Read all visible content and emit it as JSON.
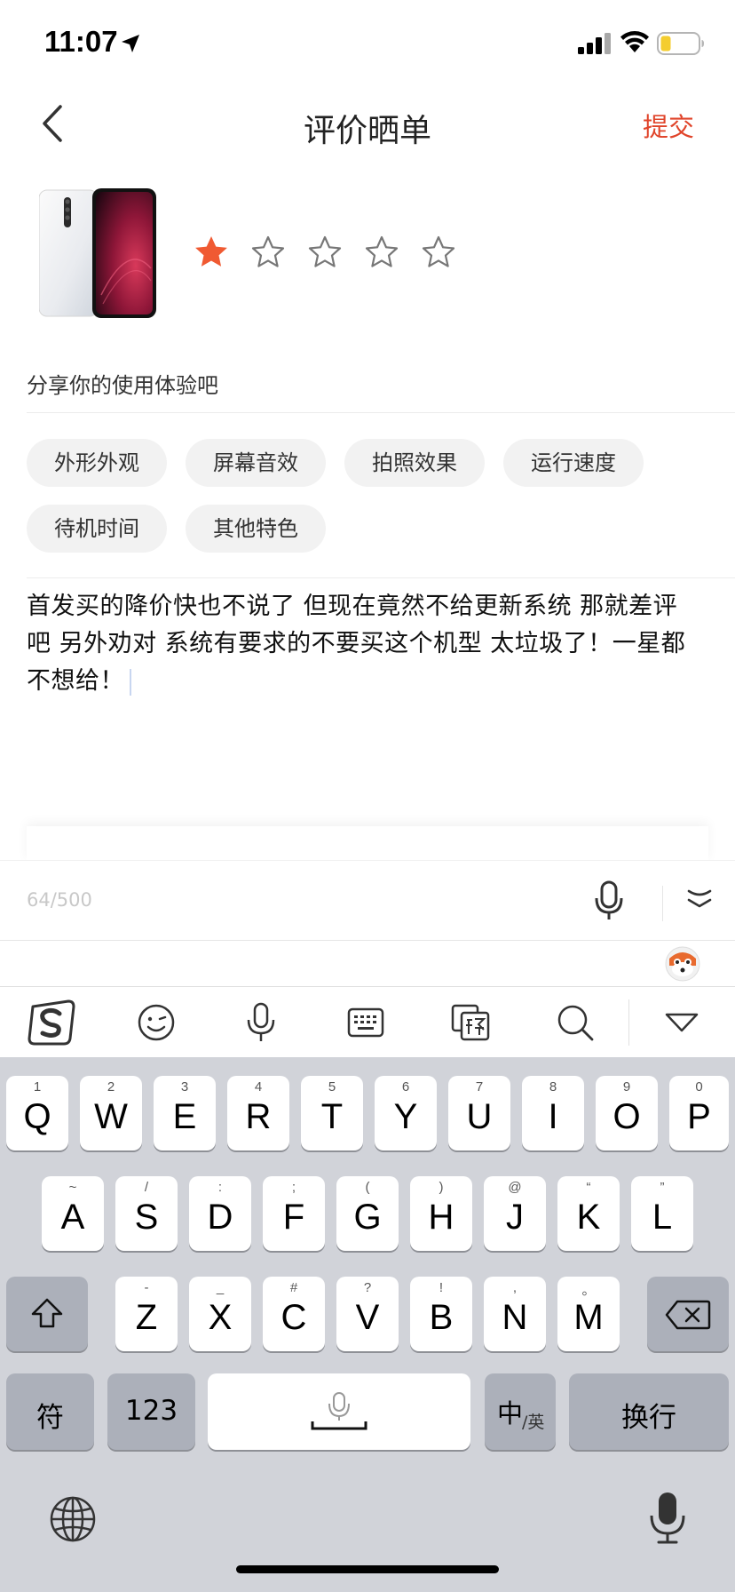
{
  "status_bar": {
    "time": "11:07"
  },
  "nav": {
    "title": "评价晒单",
    "submit_label": "提交"
  },
  "rating": {
    "value": 1,
    "max": 5,
    "filled_color": "#f05a32",
    "empty_color": "#777777"
  },
  "prompt": "分享你的使用体验吧",
  "tags": [
    "外形外观",
    "屏幕音效",
    "拍照效果",
    "运行速度",
    "待机时间",
    "其他特色"
  ],
  "review": {
    "text": "首发买的降价快也不说了 但现在竟然不给更新系统 那就差评吧 另外劝对 系统有要求的不要买这个机型 太垃圾了！一星都不想给！"
  },
  "char_count": "64/500",
  "accent_color": "#e0442a",
  "ime_toolbar": [
    "sogou-logo-icon",
    "emoji-icon",
    "voice-icon",
    "keyboard-icon",
    "translate-icon",
    "search-icon",
    "collapse-keyboard-icon"
  ],
  "keyboard": {
    "row1": [
      {
        "main": "Q",
        "sub": "1"
      },
      {
        "main": "W",
        "sub": "2"
      },
      {
        "main": "E",
        "sub": "3"
      },
      {
        "main": "R",
        "sub": "4"
      },
      {
        "main": "T",
        "sub": "5"
      },
      {
        "main": "Y",
        "sub": "6"
      },
      {
        "main": "U",
        "sub": "7"
      },
      {
        "main": "I",
        "sub": "8"
      },
      {
        "main": "O",
        "sub": "9"
      },
      {
        "main": "P",
        "sub": "0"
      }
    ],
    "row2": [
      {
        "main": "A",
        "sub": "~"
      },
      {
        "main": "S",
        "sub": "/"
      },
      {
        "main": "D",
        "sub": ":"
      },
      {
        "main": "F",
        "sub": ";"
      },
      {
        "main": "G",
        "sub": "("
      },
      {
        "main": "H",
        "sub": ")"
      },
      {
        "main": "J",
        "sub": "@"
      },
      {
        "main": "K",
        "sub": "“"
      },
      {
        "main": "L",
        "sub": "”"
      }
    ],
    "row3": [
      {
        "main": "Z",
        "sub": "-"
      },
      {
        "main": "X",
        "sub": "_"
      },
      {
        "main": "C",
        "sub": "#"
      },
      {
        "main": "V",
        "sub": "?"
      },
      {
        "main": "B",
        "sub": "!"
      },
      {
        "main": "N",
        "sub": ","
      },
      {
        "main": "M",
        "sub": "。"
      }
    ],
    "symbols_label": "符",
    "numbers_label": "123",
    "lang_label": "中",
    "lang_sub": "/英",
    "return_label": "换行"
  }
}
